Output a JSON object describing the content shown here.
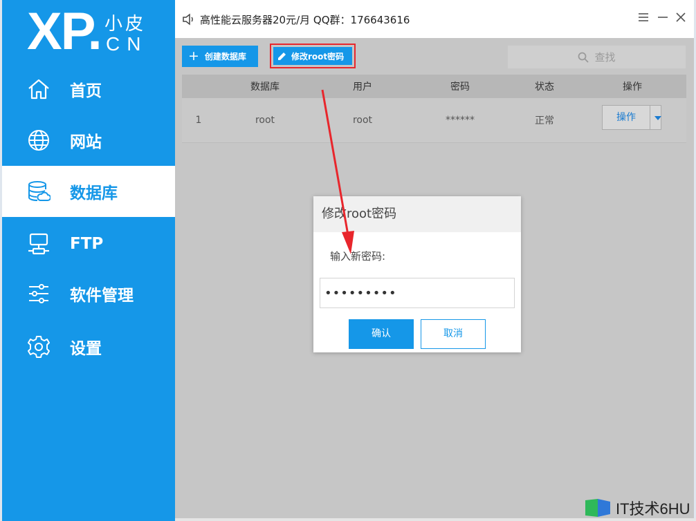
{
  "logo": {
    "xp": "XP.",
    "cn_top": "小皮",
    "cn_bottom": "CN"
  },
  "sidebar": {
    "items": [
      {
        "label": "首页",
        "icon": "home-icon",
        "active": false
      },
      {
        "label": "网站",
        "icon": "globe-icon",
        "active": false
      },
      {
        "label": "数据库",
        "icon": "database-icon",
        "active": true
      },
      {
        "label": "FTP",
        "icon": "ftp-server-icon",
        "active": false
      },
      {
        "label": "软件管理",
        "icon": "sliders-icon",
        "active": false
      },
      {
        "label": "设置",
        "icon": "gear-icon",
        "active": false
      }
    ]
  },
  "titlebar": {
    "text": "高性能云服务器20元/月  QQ群：176643616"
  },
  "toolbar": {
    "create_label": "创建数据库",
    "change_root_label": "修改root密码",
    "search_placeholder": "查找"
  },
  "table": {
    "columns": [
      "数据库",
      "用户",
      "密码",
      "状态",
      "操作"
    ],
    "rows": [
      {
        "index": "1",
        "database": "root",
        "user": "root",
        "password": "******",
        "status": "正常",
        "action": "操作"
      }
    ]
  },
  "modal": {
    "title": "修改root密码",
    "label": "输入新密码:",
    "input_value": "•••••••••",
    "ok_label": "确认",
    "cancel_label": "取消"
  },
  "watermark": {
    "text": "IT技术6HU"
  },
  "colors": {
    "accent": "#1597e8",
    "highlight": "#e8262c",
    "overlay": "#c6c6c6"
  }
}
